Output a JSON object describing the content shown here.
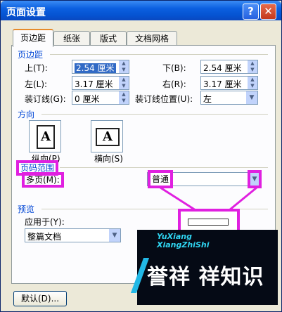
{
  "window": {
    "title": "页面设置",
    "help_icon": "?",
    "close_icon": "✕"
  },
  "tabs": [
    "页边距",
    "纸张",
    "版式",
    "文档网格"
  ],
  "margins": {
    "group_label": "页边距",
    "top": {
      "label": "上(T):",
      "value": "2.54 厘米"
    },
    "bottom": {
      "label": "下(B):",
      "value": "2.54 厘米"
    },
    "left": {
      "label": "左(L):",
      "value": "3.17 厘米"
    },
    "right": {
      "label": "右(R):",
      "value": "3.17 厘米"
    },
    "gutter": {
      "label": "装订线(G):",
      "value": "0 厘米"
    },
    "gutter_position": {
      "label": "装订线位置(U):",
      "value": "左"
    }
  },
  "orientation": {
    "group_label": "方向",
    "portrait_label": "纵向(P)",
    "landscape_label": "横向(S)",
    "page_glyph": "A"
  },
  "pages": {
    "group_label": "页码范围",
    "multiple_label": "多页(M):",
    "multiple_value": "普通"
  },
  "preview": {
    "group_label": "预览",
    "apply_label": "应用于(Y):",
    "apply_value": "整篇文档"
  },
  "buttons": {
    "default": "默认(D)..."
  },
  "watermark": {
    "tag_line1": "YuXiang",
    "tag_line2": "XiangZhiShi",
    "text": "誉祥 祥知识"
  },
  "colors": {
    "highlight": "#e020e0",
    "title_bar": "#0553d1",
    "group_label": "#0046d5"
  }
}
